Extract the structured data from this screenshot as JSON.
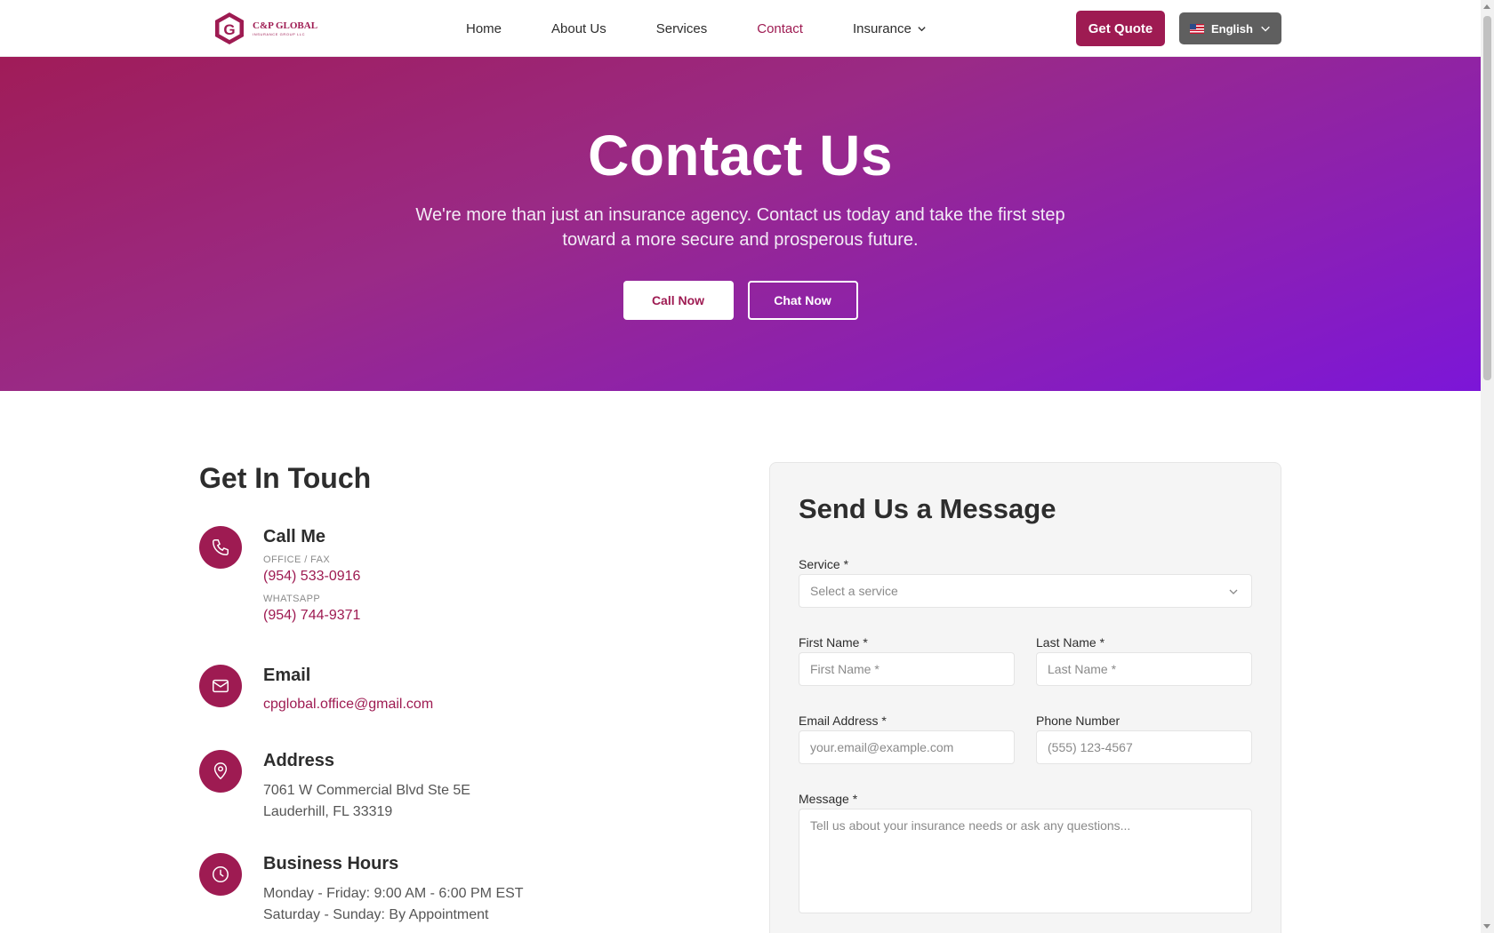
{
  "header": {
    "logo": {
      "title": "C&P GLOBAL",
      "subtitle": "INSURANCE GROUP LLC"
    },
    "nav": [
      {
        "label": "Home"
      },
      {
        "label": "About Us"
      },
      {
        "label": "Services"
      },
      {
        "label": "Contact",
        "active": true
      },
      {
        "label": "Insurance",
        "has_dropdown": true
      }
    ],
    "quote_button": "Get Quote",
    "language": {
      "label": "English",
      "flag": "us-flag-icon"
    }
  },
  "hero": {
    "title": "Contact Us",
    "subtitle": "We're more than just an insurance agency. Contact us today and take the first step toward a more secure and prosperous future.",
    "call_button": "Call Now",
    "chat_button": "Chat Now"
  },
  "contact": {
    "title": "Get In Touch",
    "call": {
      "heading": "Call Me",
      "office_label": "OFFICE / FAX",
      "office_phone": "(954) 533-0916",
      "whatsapp_label": "WHATSAPP",
      "whatsapp_phone": "(954) 744-9371"
    },
    "email": {
      "heading": "Email",
      "address": "cpglobal.office@gmail.com"
    },
    "address": {
      "heading": "Address",
      "line1": "7061 W Commercial Blvd Ste 5E",
      "line2": "Lauderhill, FL 33319"
    },
    "hours": {
      "heading": "Business Hours",
      "line1": "Monday - Friday: 9:00 AM - 6:00 PM EST",
      "line2": "Saturday - Sunday: By Appointment"
    }
  },
  "form": {
    "title": "Send Us a Message",
    "service": {
      "label": "Service *",
      "placeholder": "Select a service"
    },
    "first_name": {
      "label": "First Name *",
      "placeholder": "First Name *"
    },
    "last_name": {
      "label": "Last Name *",
      "placeholder": "Last Name *"
    },
    "email": {
      "label": "Email Address *",
      "placeholder": "your.email@example.com"
    },
    "phone": {
      "label": "Phone Number",
      "placeholder": "(555) 123-4567"
    },
    "message": {
      "label": "Message *",
      "placeholder": "Tell us about your insurance needs or ask any questions..."
    }
  },
  "colors": {
    "brand": "#9e1b52",
    "hero_gradient_start": "#a01c58",
    "hero_gradient_end": "#7c16d8",
    "language_button": "#5f5f5f"
  }
}
